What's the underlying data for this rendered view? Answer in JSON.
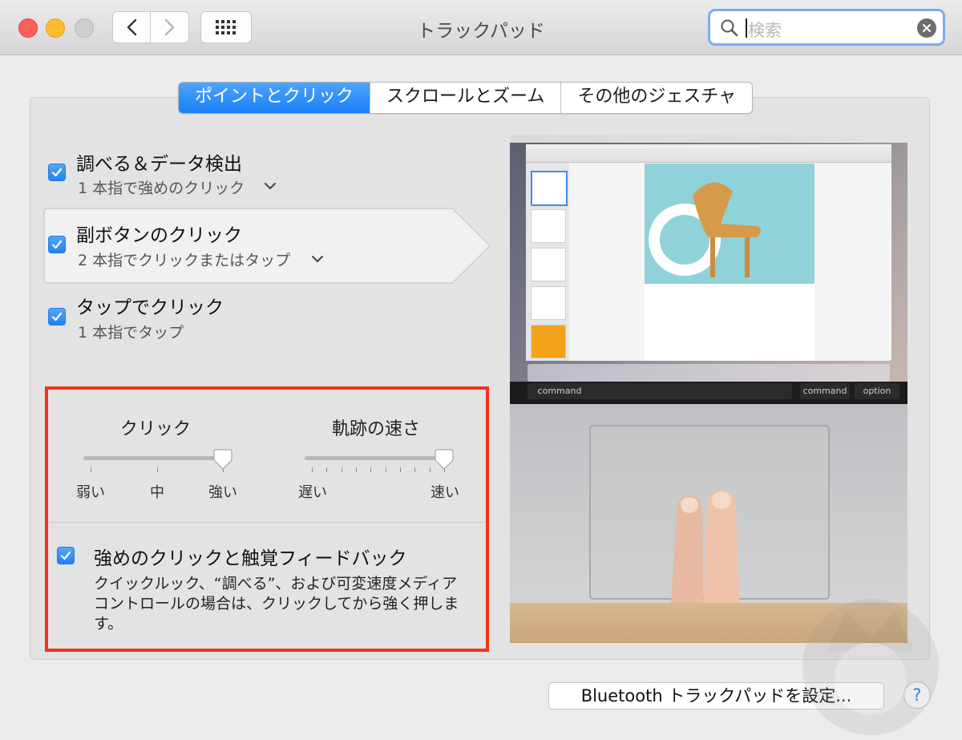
{
  "window": {
    "title": "トラックパッド"
  },
  "search": {
    "placeholder": "検索"
  },
  "tabs": [
    {
      "label": "ポイントとクリック",
      "active": true
    },
    {
      "label": "スクロールとズーム",
      "active": false
    },
    {
      "label": "その他のジェスチャ",
      "active": false
    }
  ],
  "options": [
    {
      "title": "調べる＆データ検出",
      "subtitle": "1 本指で強めのクリック",
      "checked": true,
      "has_dropdown": true
    },
    {
      "title": "副ボタンのクリック",
      "subtitle": "2 本指でクリックまたはタップ",
      "checked": true,
      "has_dropdown": true,
      "selected": true
    },
    {
      "title": "タップでクリック",
      "subtitle": "1 本指でタップ",
      "checked": true,
      "has_dropdown": false
    }
  ],
  "sliders": {
    "click": {
      "label": "クリック",
      "ticks": [
        "弱い",
        "中",
        "強い"
      ],
      "value_index": 2,
      "tick_count": 3
    },
    "speed": {
      "label": "軌跡の速さ",
      "min_label": "遅い",
      "max_label": "速い",
      "value_fraction": 1.0,
      "tick_count": 10
    }
  },
  "force_click": {
    "title": "強めのクリックと触覚フィードバック",
    "description": "クイックルック、“調べる”、および可変速度メディアコントロールの場合は、クリックしてから強く押します。",
    "checked": true
  },
  "preview": {
    "keys": [
      "command",
      "command",
      "option"
    ]
  },
  "footer": {
    "bluetooth_button": "Bluetooth トラックパッドを設定...",
    "help_label": "?"
  },
  "colors": {
    "accent": "#1e82f5",
    "highlight_border": "#f3321c"
  }
}
